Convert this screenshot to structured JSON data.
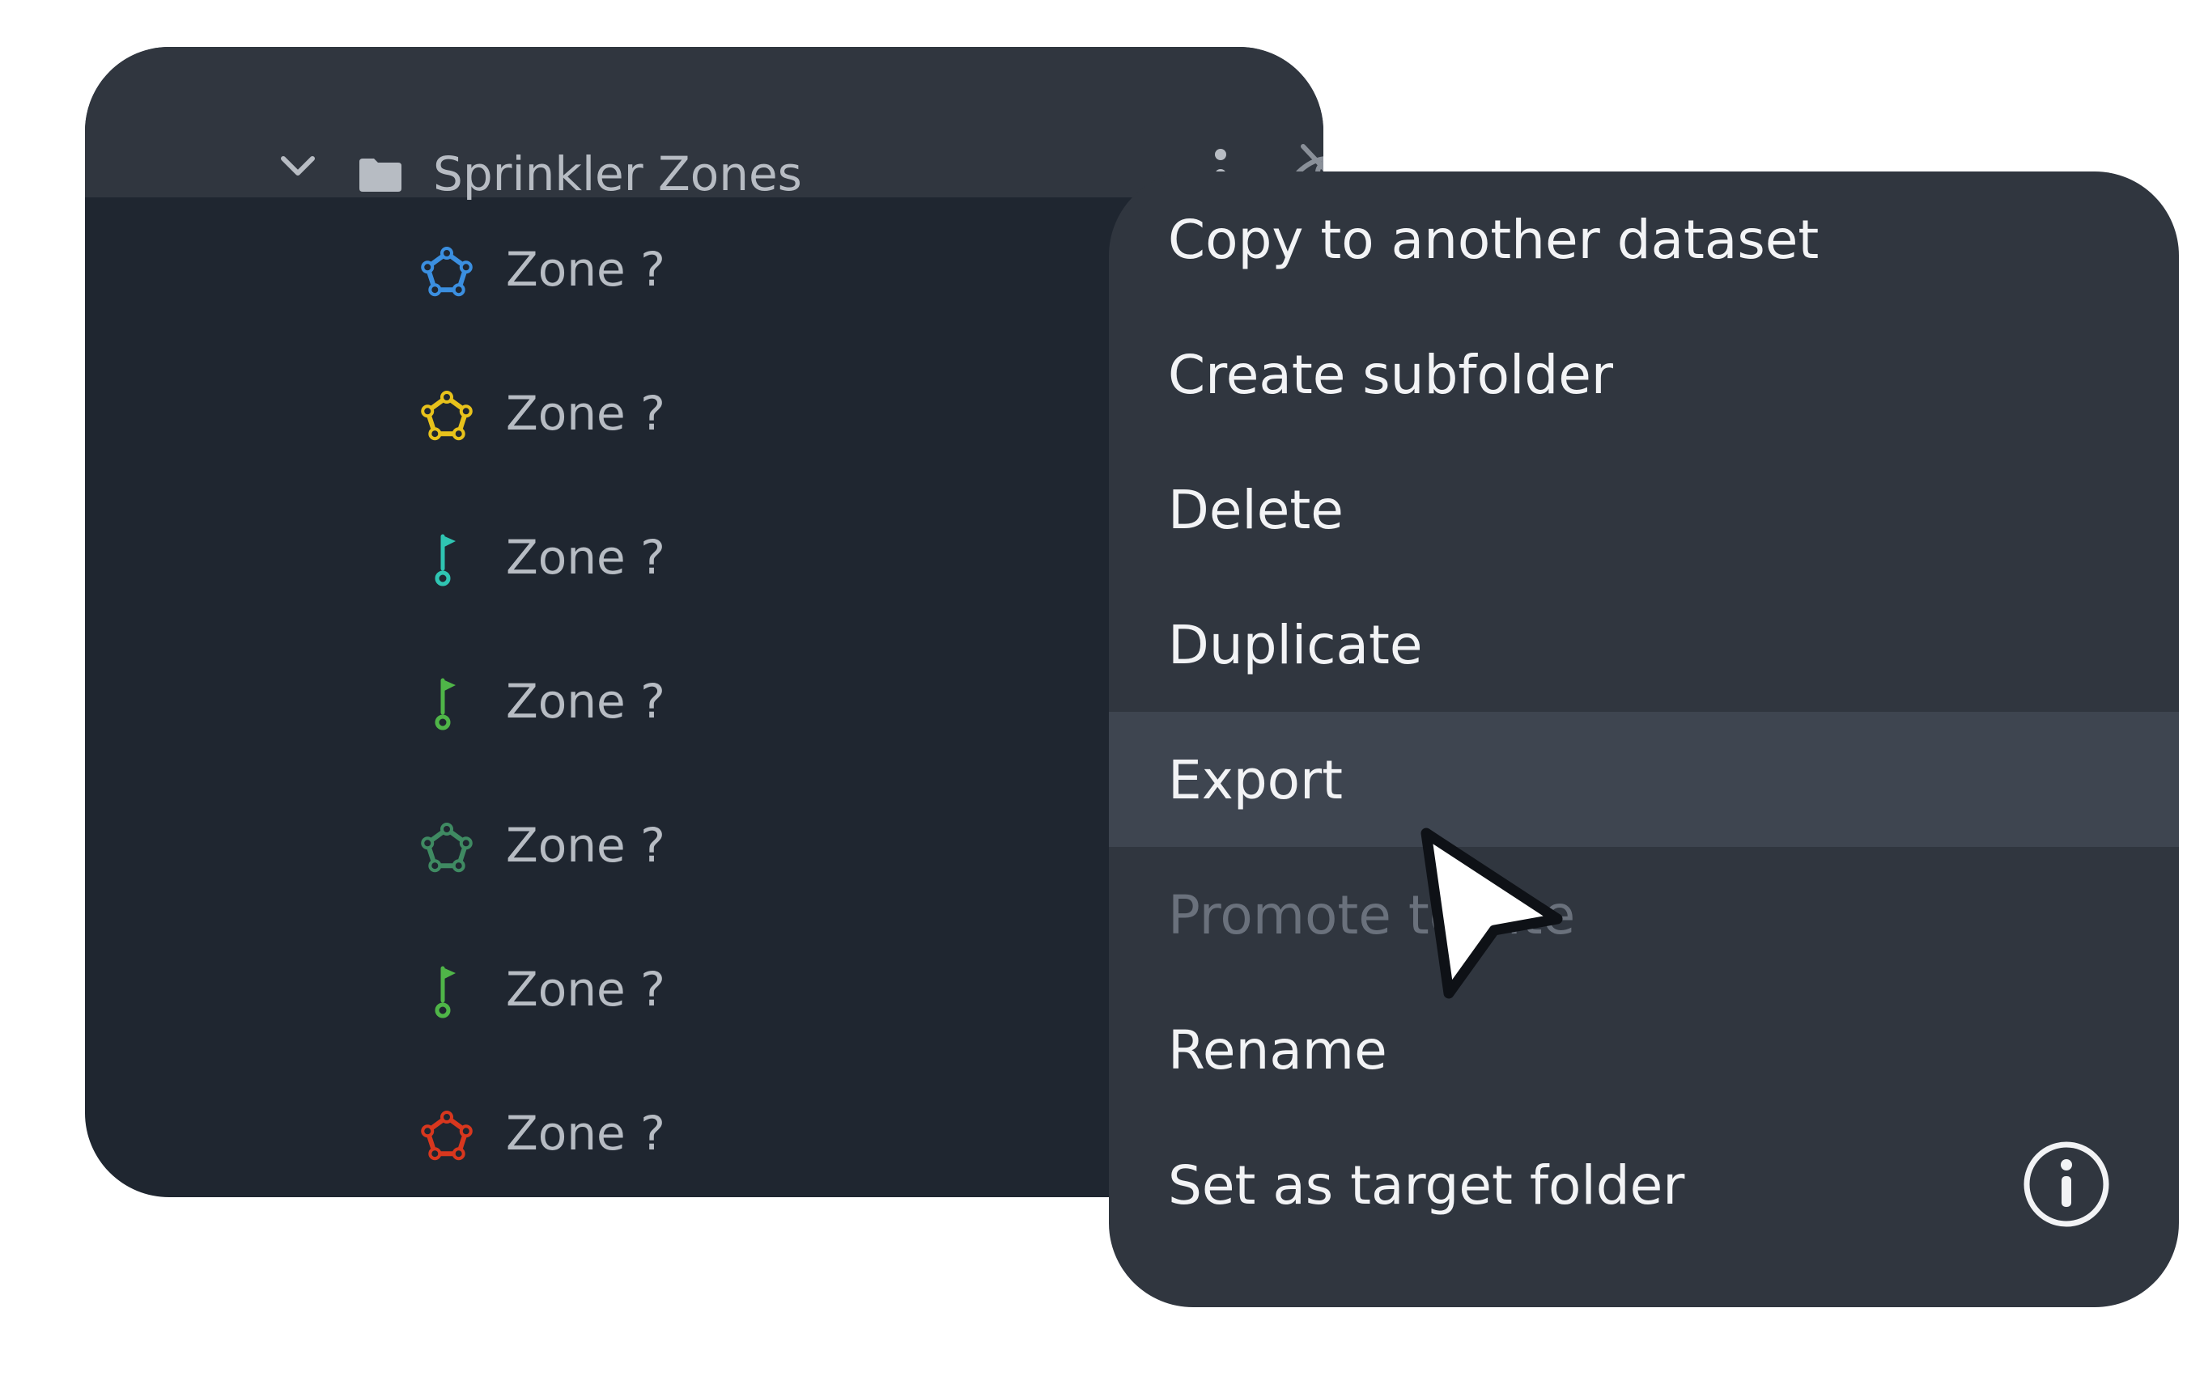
{
  "layer_panel": {
    "folder": {
      "name": "Sprinkler Zones",
      "expanded": true,
      "icon": "folder-icon",
      "visibility_icon": "eye-off-icon"
    },
    "layers": [
      {
        "name": "Zone ?",
        "icon": "polygon-icon",
        "color": "#3b8fe0"
      },
      {
        "name": "Zone ?",
        "icon": "polygon-icon",
        "color": "#e8c21b"
      },
      {
        "name": "Zone ?",
        "icon": "flag-pin-icon",
        "color": "#2fc4b2"
      },
      {
        "name": "Zone ?",
        "icon": "flag-pin-icon",
        "color": "#4fb548"
      },
      {
        "name": "Zone ?",
        "icon": "polygon-icon",
        "color": "#3f8a62"
      },
      {
        "name": "Zone ?",
        "icon": "flag-pin-icon",
        "color": "#4fb548"
      },
      {
        "name": "Zone ?",
        "icon": "polygon-icon",
        "color": "#d8371e"
      }
    ]
  },
  "context_menu": {
    "items": [
      {
        "label": "Copy to another dataset",
        "state": "normal"
      },
      {
        "label": "Create subfolder",
        "state": "normal"
      },
      {
        "label": "Delete",
        "state": "normal"
      },
      {
        "label": "Duplicate",
        "state": "normal"
      },
      {
        "label": "Export",
        "state": "highlighted"
      },
      {
        "label": "Promote to site",
        "state": "disabled"
      },
      {
        "label": "Rename",
        "state": "normal"
      },
      {
        "label": "Set as target folder",
        "state": "normal",
        "trailing_icon": "info-icon"
      }
    ]
  }
}
